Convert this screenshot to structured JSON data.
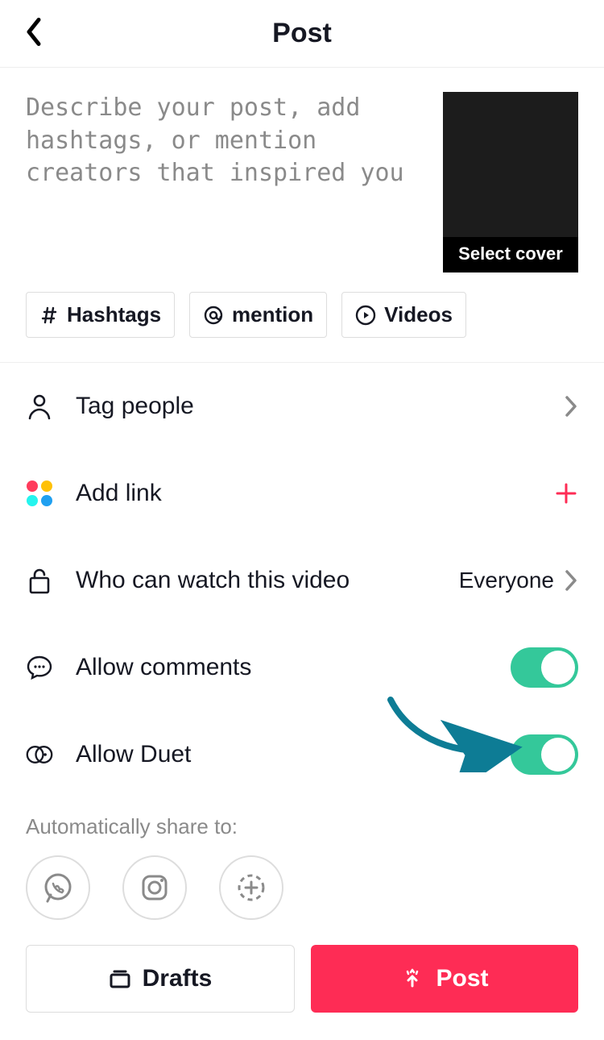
{
  "header": {
    "title": "Post"
  },
  "caption": {
    "placeholder": "Describe your post, add hashtags, or mention creators that inspired you",
    "value": ""
  },
  "cover": {
    "label": "Select cover"
  },
  "chips": {
    "hashtags": "Hashtags",
    "mention": "mention",
    "videos": "Videos"
  },
  "options": {
    "tag_people": {
      "label": "Tag people"
    },
    "add_link": {
      "label": "Add link"
    },
    "privacy": {
      "label": "Who can watch this video",
      "value": "Everyone"
    },
    "allow_comments": {
      "label": "Allow comments",
      "on": true
    },
    "allow_duet": {
      "label": "Allow Duet",
      "on": true
    }
  },
  "share": {
    "label": "Automatically share to:",
    "targets": [
      "whatsapp",
      "instagram",
      "more"
    ]
  },
  "bottom": {
    "drafts": "Drafts",
    "post": "Post"
  },
  "annotation": {
    "arrow_color": "#0d7c95"
  },
  "colors": {
    "fourdots": [
      "#ff3b5c",
      "#ffc107",
      "#25f4ee",
      "#20a0f0"
    ]
  }
}
